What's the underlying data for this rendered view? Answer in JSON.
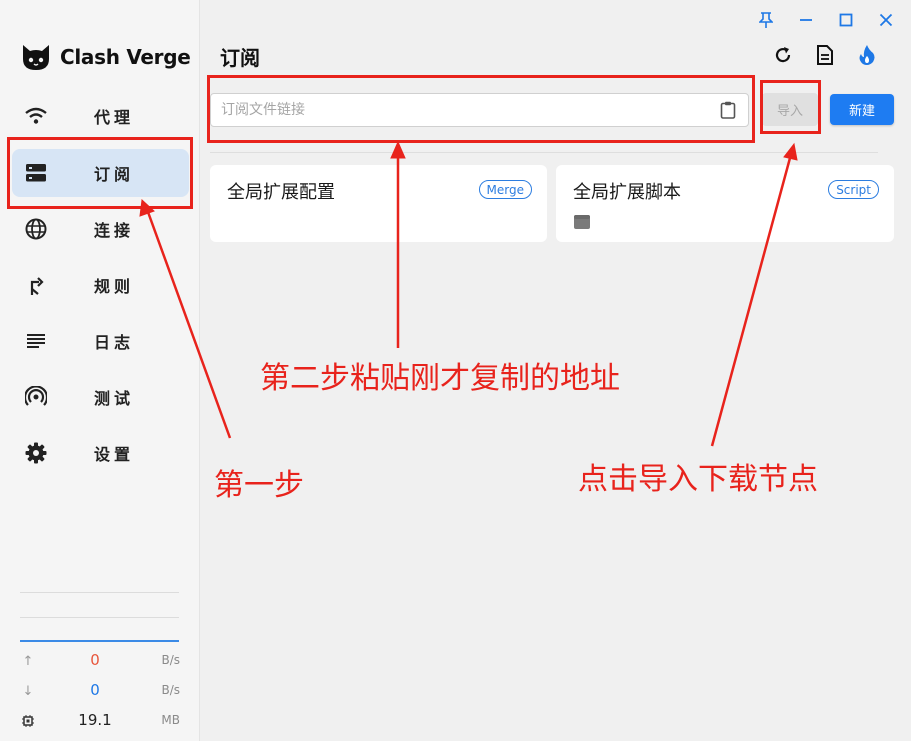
{
  "app": {
    "name": "Clash Verge"
  },
  "sidebar": {
    "items": [
      {
        "label": "代理",
        "icon": "wifi-icon"
      },
      {
        "label": "订阅",
        "icon": "server-icon",
        "active": true
      },
      {
        "label": "连接",
        "icon": "globe-icon"
      },
      {
        "label": "规则",
        "icon": "fork-arrow-icon"
      },
      {
        "label": "日志",
        "icon": "lines-icon"
      },
      {
        "label": "测试",
        "icon": "signal-icon"
      },
      {
        "label": "设置",
        "icon": "gear-icon"
      }
    ],
    "traffic": {
      "up": {
        "value": "0",
        "unit": "B/s",
        "color": "#e8563c"
      },
      "down": {
        "value": "0",
        "unit": "B/s",
        "color": "#1e78e6"
      },
      "memory": {
        "value": "19.1",
        "unit": "MB"
      }
    }
  },
  "header": {
    "title": "订阅"
  },
  "subscription": {
    "url_placeholder": "订阅文件链接",
    "url_value": "",
    "import_label": "导入",
    "new_label": "新建"
  },
  "cards": [
    {
      "title": "全局扩展配置",
      "badge": "Merge"
    },
    {
      "title": "全局扩展脚本",
      "badge": "Script"
    }
  ],
  "annotations": {
    "step1": "第一步",
    "step2": "第二步粘贴刚才复制的地址",
    "step3": "点击导入下载节点",
    "color": "#e8231c"
  },
  "colors": {
    "accent": "#1e7cf2",
    "active_bg": "#d7e5f5"
  }
}
